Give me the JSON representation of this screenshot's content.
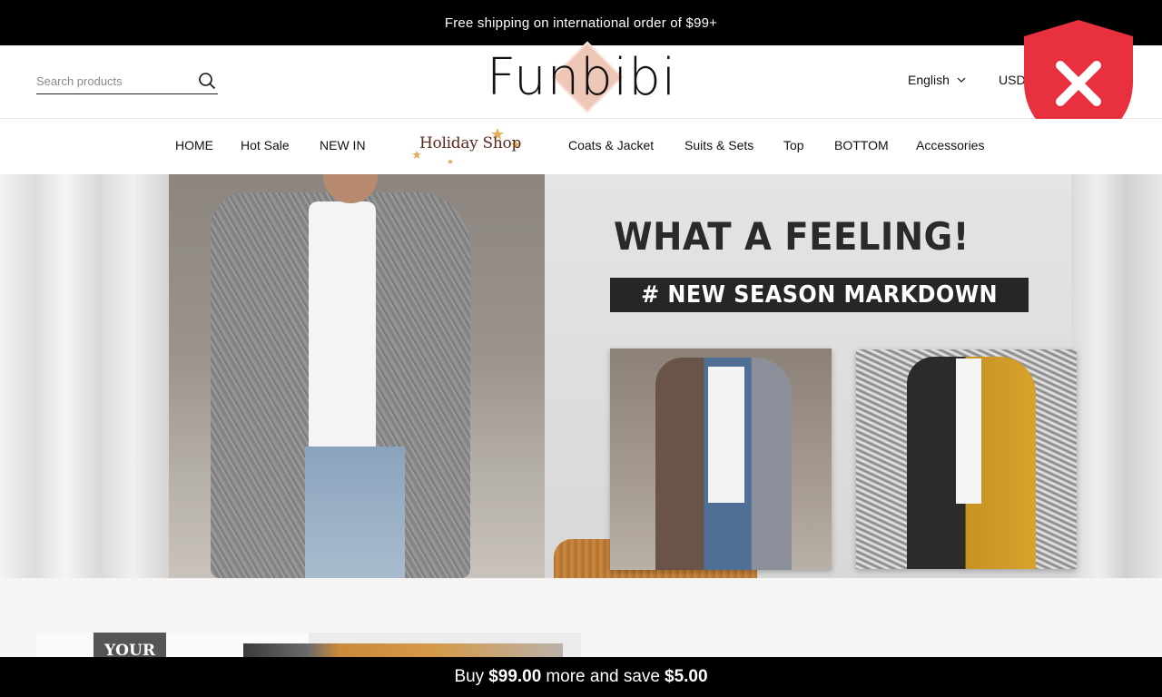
{
  "announcement": "Free shipping on international order of $99+",
  "search": {
    "placeholder": "Search products"
  },
  "logo": {
    "text": "Funbibi"
  },
  "header": {
    "language": "English",
    "currency": "USD"
  },
  "nav": {
    "items": [
      "HOME",
      "Hot Sale",
      "NEW IN",
      "Coats & Jacket",
      "Suits & Sets",
      "Top",
      "BOTTOM",
      "Accessories"
    ],
    "holiday_shop": "Holiday Shop"
  },
  "hero": {
    "headline": "WHAT A FEELING!",
    "tagline": "# NEW SEASON MARKDOWN"
  },
  "promo_tile": {
    "label": "YOUR"
  },
  "bottom_bar": {
    "prefix": "Buy",
    "threshold": "$99.00",
    "middle": "more and save",
    "saving": "$5.00"
  },
  "colors": {
    "shield": "#e8303f",
    "accent_logo": "#efc7b6",
    "bar": "#000000"
  },
  "icons": [
    "search-icon",
    "chevron-down-icon",
    "security-shield-close-icon"
  ]
}
